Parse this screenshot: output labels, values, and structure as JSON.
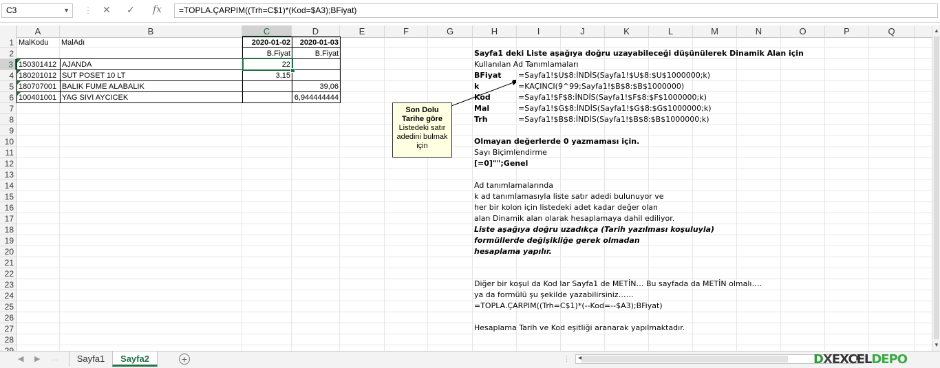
{
  "formula_bar": {
    "name_box": "C3",
    "formula": "=TOPLA.ÇARPIM((Trh=C$1)*(Kod=$A3);BFiyat)"
  },
  "columns": [
    "A",
    "B",
    "C",
    "D",
    "E",
    "F",
    "G",
    "H",
    "I",
    "J",
    "K",
    "L",
    "M",
    "N",
    "O",
    "P",
    "Q"
  ],
  "rows": [
    "1",
    "2",
    "3",
    "4",
    "5",
    "6",
    "7",
    "8",
    "9",
    "10",
    "11",
    "12",
    "13",
    "14",
    "15",
    "16",
    "17",
    "18",
    "19",
    "20",
    "21",
    "22",
    "23",
    "24",
    "25",
    "26",
    "27",
    "28",
    "29"
  ],
  "cells": {
    "a1": "MalKodu",
    "b1": "MalAdı",
    "c1": "2020-01-02",
    "d1": "2020-01-03",
    "c2": "B.Fiyat",
    "d2": "B.Fiyat",
    "a3": "150301412",
    "b3": "AJANDA",
    "c3": "22",
    "a4": "180201012",
    "b4": "SUT POSET 10 LT",
    "c4": "3,15",
    "a5": "180707001",
    "b5": "BALIK FUME ALABALIK",
    "d5": "39,06",
    "a6": "100401001",
    "b6": "YAG SIVI AYCICEK",
    "d6": "6,944444444"
  },
  "comment": {
    "title_line1": "Son Dolu",
    "title_line2": "Tarihe göre",
    "body_line1": "Listedeki satır",
    "body_line2": "adedini bulmak",
    "body_line3": "için"
  },
  "notes": {
    "heading": "Sayfa1 deki Liste aşağıya doğru uzayabileceği düşünülerek Dinamik Alan için",
    "subheading": "Kullanılan Ad Tanımlamaları",
    "defs": [
      {
        "name": "BFiyat",
        "formula": "=Sayfa1!$U$8:İNDİS(Sayfa1!$U$8:$U$1000000;k)"
      },
      {
        "name": "k",
        "formula": "=KAÇINCI(9^99;Sayfa1!$B$8:$B$1000000)"
      },
      {
        "name": "Kod",
        "formula": "=Sayfa1!$F$8:İNDİS(Sayfa1!$F$8:$F$1000000;k)"
      },
      {
        "name": "Mal",
        "formula": "=Sayfa1!$G$8:İNDİS(Sayfa1!$G$8:$G$1000000;k)"
      },
      {
        "name": "Trh",
        "formula": "=Sayfa1!$B$8:İNDİS(Sayfa1!$B$8:$B$1000000;k)"
      }
    ],
    "zero_title": "Olmayan değerlerde  0  yazmaması için.",
    "zero_line2": "Sayı Biçimlendirme",
    "zero_format": "[=0]\"\";Genel",
    "p1": "Ad tanımlamalarında",
    "p2": "k  ad tanımlamasıyla liste satır adedi bulunuyor ve",
    "p3": "her bir kolon için listedeki adet kadar değer olan",
    "p4": "alan Dinamik alan olarak hesaplamaya dahil ediliyor.",
    "p5": "Liste aşağıya doğru uzadıkça (Tarih yazılması koşuluyla)",
    "p6": "formüllerde değişikliğe gerek olmadan",
    "p7": "hesaplama yapılır.",
    "q1": "Diğer bir koşul da Kod lar Sayfa1 de METİN… Bu sayfada da METİN olmalı….",
    "q2": "ya da  formülü  şu şekilde yazabilirsiniz……",
    "q3": " =TOPLA.ÇARPIM((Trh=C$1)*(--Kod=--$A3);BFiyat)",
    "q4": "Hesaplama Tarih ve Kod eşitliği aranarak yapılmaktadır."
  },
  "sheets": {
    "tab1": "Sayfa1",
    "tab2": "Sayfa2",
    "active": "Sayfa2"
  },
  "logo": {
    "part1": "D",
    "part2": "X",
    "part3": "EXCEL",
    "part4": "DEPO"
  },
  "colors": {
    "accent": "#217346",
    "comment_bg": "#ffffe1"
  }
}
